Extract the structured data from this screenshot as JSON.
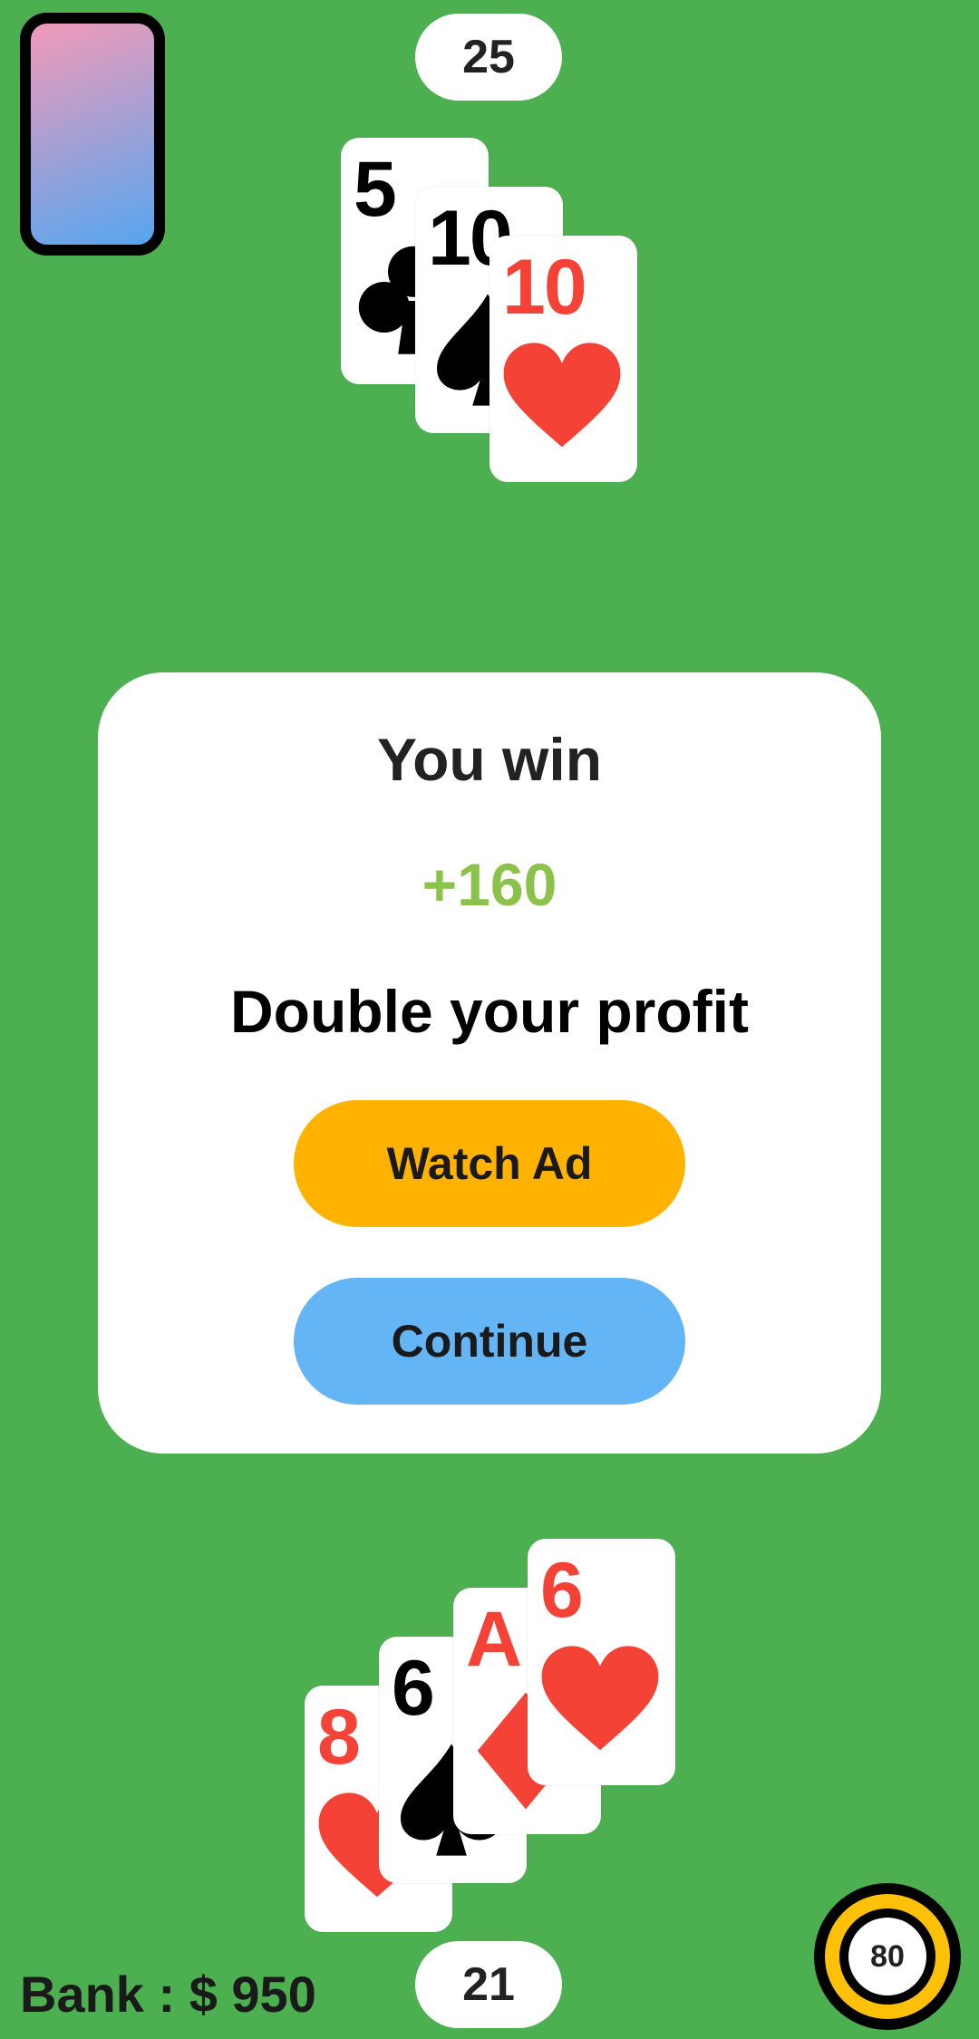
{
  "dealer": {
    "score": "25",
    "cards": [
      {
        "rank": "5",
        "suit": "club"
      },
      {
        "rank": "10",
        "suit": "spade"
      },
      {
        "rank": "10",
        "suit": "heart"
      }
    ]
  },
  "player": {
    "score": "21",
    "cards": [
      {
        "rank": "8",
        "suit": "heart"
      },
      {
        "rank": "6",
        "suit": "spade"
      },
      {
        "rank": "A",
        "suit": "diamond"
      },
      {
        "rank": "6",
        "suit": "heart"
      }
    ]
  },
  "dialog": {
    "title": "You win",
    "reward": "+160",
    "subtitle": "Double your profit",
    "watch_ad_label": "Watch Ad",
    "continue_label": "Continue"
  },
  "bank": {
    "label": "Bank : $ 950"
  },
  "chip": {
    "value": "80"
  },
  "colors": {
    "table": "#4caf50",
    "reward": "#8bc34a",
    "watch_ad": "#ffb300",
    "continue": "#64b5f6",
    "red_suit": "#f44336",
    "black_suit": "#000000"
  },
  "icons": {
    "deck": "card-back-icon",
    "chip": "chip-icon"
  }
}
